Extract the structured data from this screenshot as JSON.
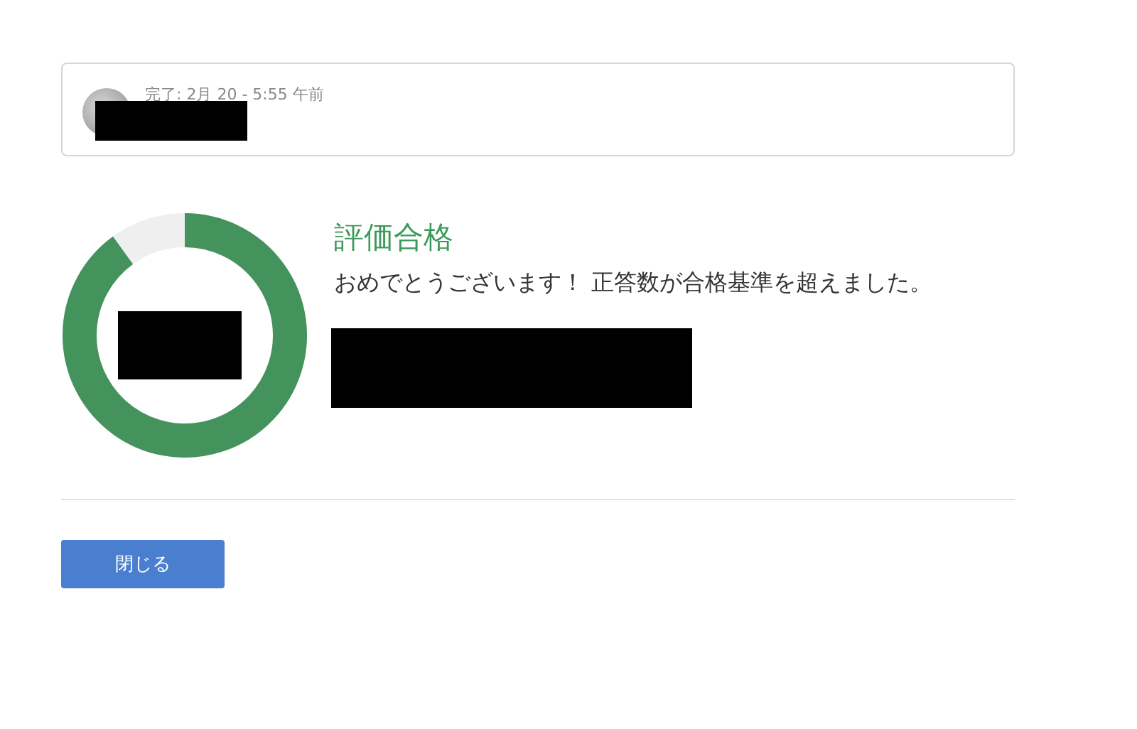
{
  "submission": {
    "status": "完了: 2月 20 - 5:55 午前"
  },
  "result": {
    "title": "評価合格",
    "message": "おめでとうございます！ 正答数が合格基準を超えました。"
  },
  "buttons": [
    {
      "label": "閉じる"
    }
  ]
}
